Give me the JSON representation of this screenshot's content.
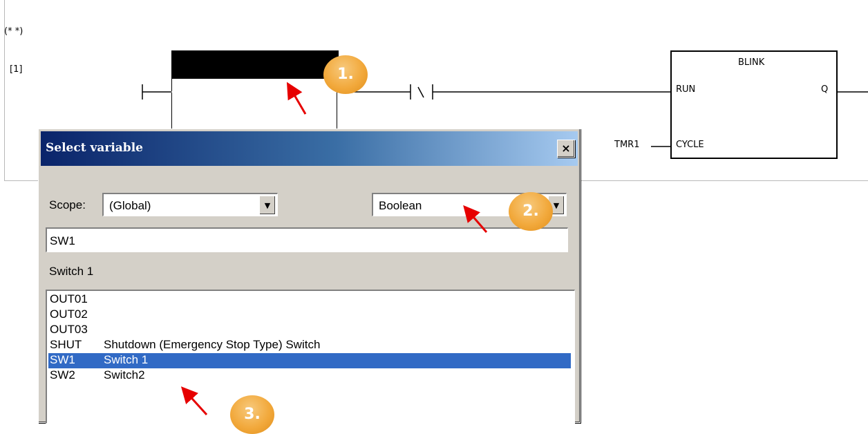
{
  "ladder": {
    "comment": "(* *)",
    "rung_number": "[1]",
    "function_block": {
      "name": "BLINK",
      "input_run": "RUN",
      "input_cycle": "CYCLE",
      "output_q": "Q",
      "cycle_variable": "TMR1"
    }
  },
  "dialog": {
    "title": "Select variable",
    "close_label": "×",
    "scope_label": "Scope:",
    "scope_value": "(Global)",
    "type_value": "Boolean",
    "name_value": "SW1",
    "description": "Switch 1",
    "filter_icons": [
      "io-icon",
      "analog-icon",
      "timer-icon",
      "string-icon"
    ],
    "variables": [
      {
        "name": "OUT01",
        "desc": ""
      },
      {
        "name": "OUT02",
        "desc": ""
      },
      {
        "name": "OUT03",
        "desc": ""
      },
      {
        "name": "SHUT",
        "desc": "Shutdown (Emergency Stop Type) Switch"
      },
      {
        "name": "SW1",
        "desc": "Switch 1",
        "selected": true
      },
      {
        "name": "SW2",
        "desc": "Switch2"
      }
    ]
  },
  "callouts": [
    "1.",
    "2.",
    "3."
  ],
  "colors": {
    "selection": "#316ac5",
    "callout": "#f2a93c",
    "arrow": "#e60000"
  }
}
